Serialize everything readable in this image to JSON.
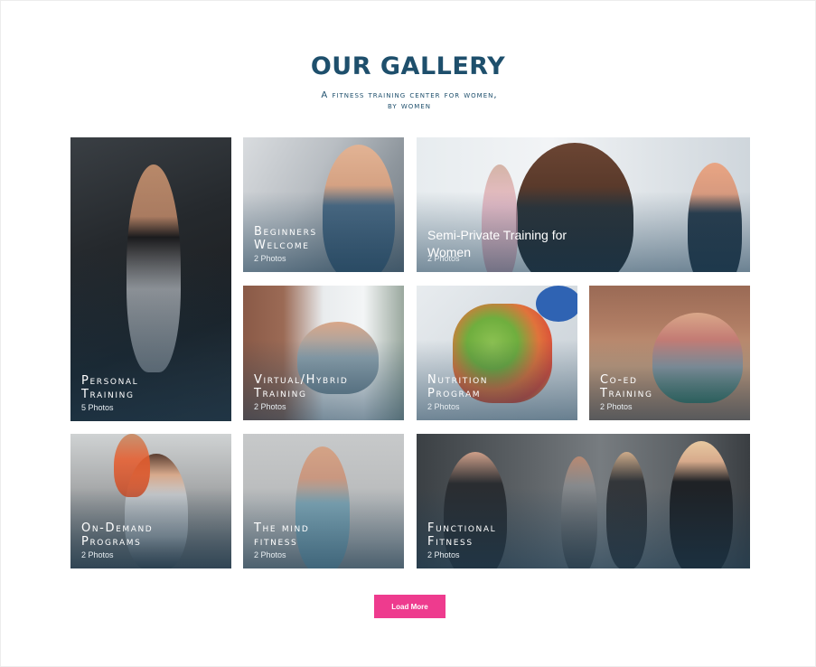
{
  "header": {
    "title": "OUR GALLERY",
    "subtitle": "A fitness training center for women, by women"
  },
  "gallery": [
    {
      "title": "Personal\nTraining",
      "count": "5 Photos"
    },
    {
      "title": "Beginners\nWelcome",
      "count": "2 Photos"
    },
    {
      "title": "Semi-Private Training for Women",
      "count": "2 Photos"
    },
    {
      "title": "Virtual/Hybrid\nTraining",
      "count": "2 Photos"
    },
    {
      "title": "Nutrition\nProgram",
      "count": "2 Photos"
    },
    {
      "title": "Co-ed\nTraining",
      "count": "2 Photos"
    },
    {
      "title": "On-Demand\nPrograms",
      "count": "2 Photos"
    },
    {
      "title": "The mind\nfitness",
      "count": "2 Photos"
    },
    {
      "title": "Functional\nFitness",
      "count": "2 Photos"
    }
  ],
  "load_more": {
    "label": "Load More"
  },
  "colors": {
    "heading": "#1e4f6c",
    "button": "#ee3b8e"
  }
}
